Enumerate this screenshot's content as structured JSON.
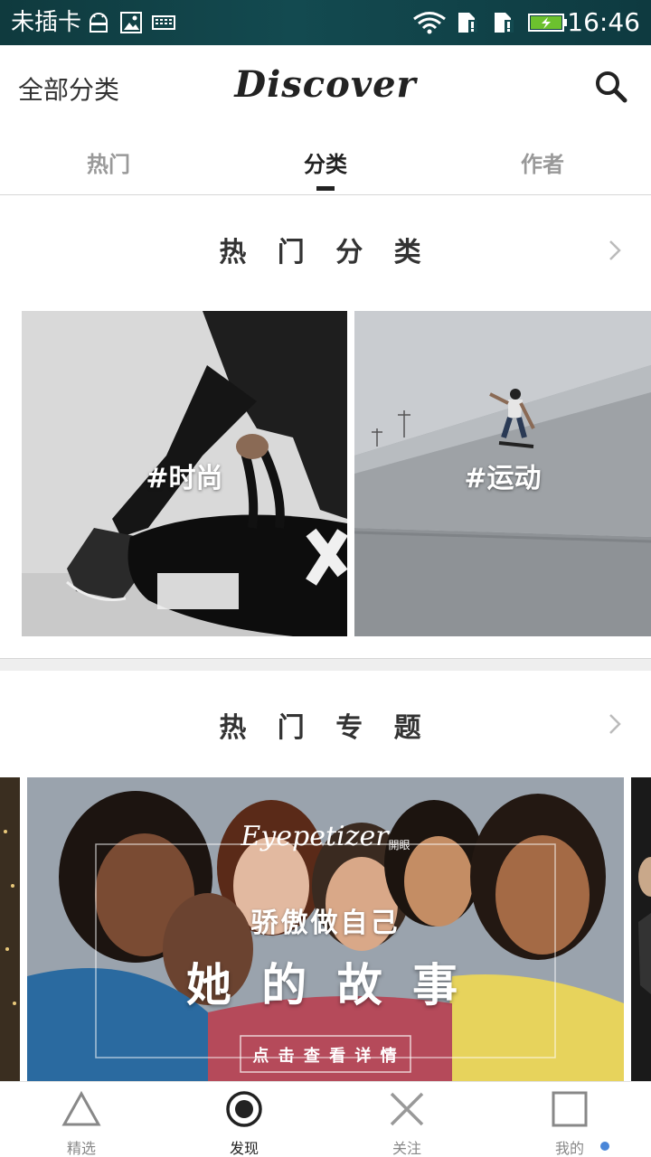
{
  "status_bar": {
    "carrier": "未插卡",
    "time": "16:46",
    "icons": [
      "android-icon",
      "image-icon",
      "keyboard-icon",
      "wifi-icon",
      "sim-alert-icon",
      "sim-alert-icon",
      "battery-charging-icon"
    ]
  },
  "header": {
    "left_label": "全部分类",
    "title": "Discover",
    "search_icon": "search-icon"
  },
  "tabs": [
    {
      "label": "热门",
      "active": false
    },
    {
      "label": "分类",
      "active": true
    },
    {
      "label": "作者",
      "active": false
    }
  ],
  "hot_categories": {
    "title": "热 门 分 类",
    "items": [
      {
        "label": "#时尚"
      },
      {
        "label": "#运动"
      }
    ]
  },
  "hot_topics": {
    "title": "热 门 专 题",
    "banner": {
      "brand": "Eyepetizer",
      "brand_cn": "開眼",
      "subtitle": "骄傲做自己",
      "headline": "她 的 故 事",
      "cta": "点 击 查 看 详 情"
    }
  },
  "bottom_nav": [
    {
      "label": "精选",
      "icon": "triangle-icon",
      "active": false
    },
    {
      "label": "发现",
      "icon": "circle-target-icon",
      "active": true
    },
    {
      "label": "关注",
      "icon": "x-cross-icon",
      "active": false
    },
    {
      "label": "我的",
      "icon": "square-icon",
      "active": false,
      "badge": true
    }
  ],
  "colors": {
    "status_bar": "#134a50",
    "text_primary": "#222222",
    "text_secondary": "#999999",
    "badge": "#4a86d8"
  }
}
